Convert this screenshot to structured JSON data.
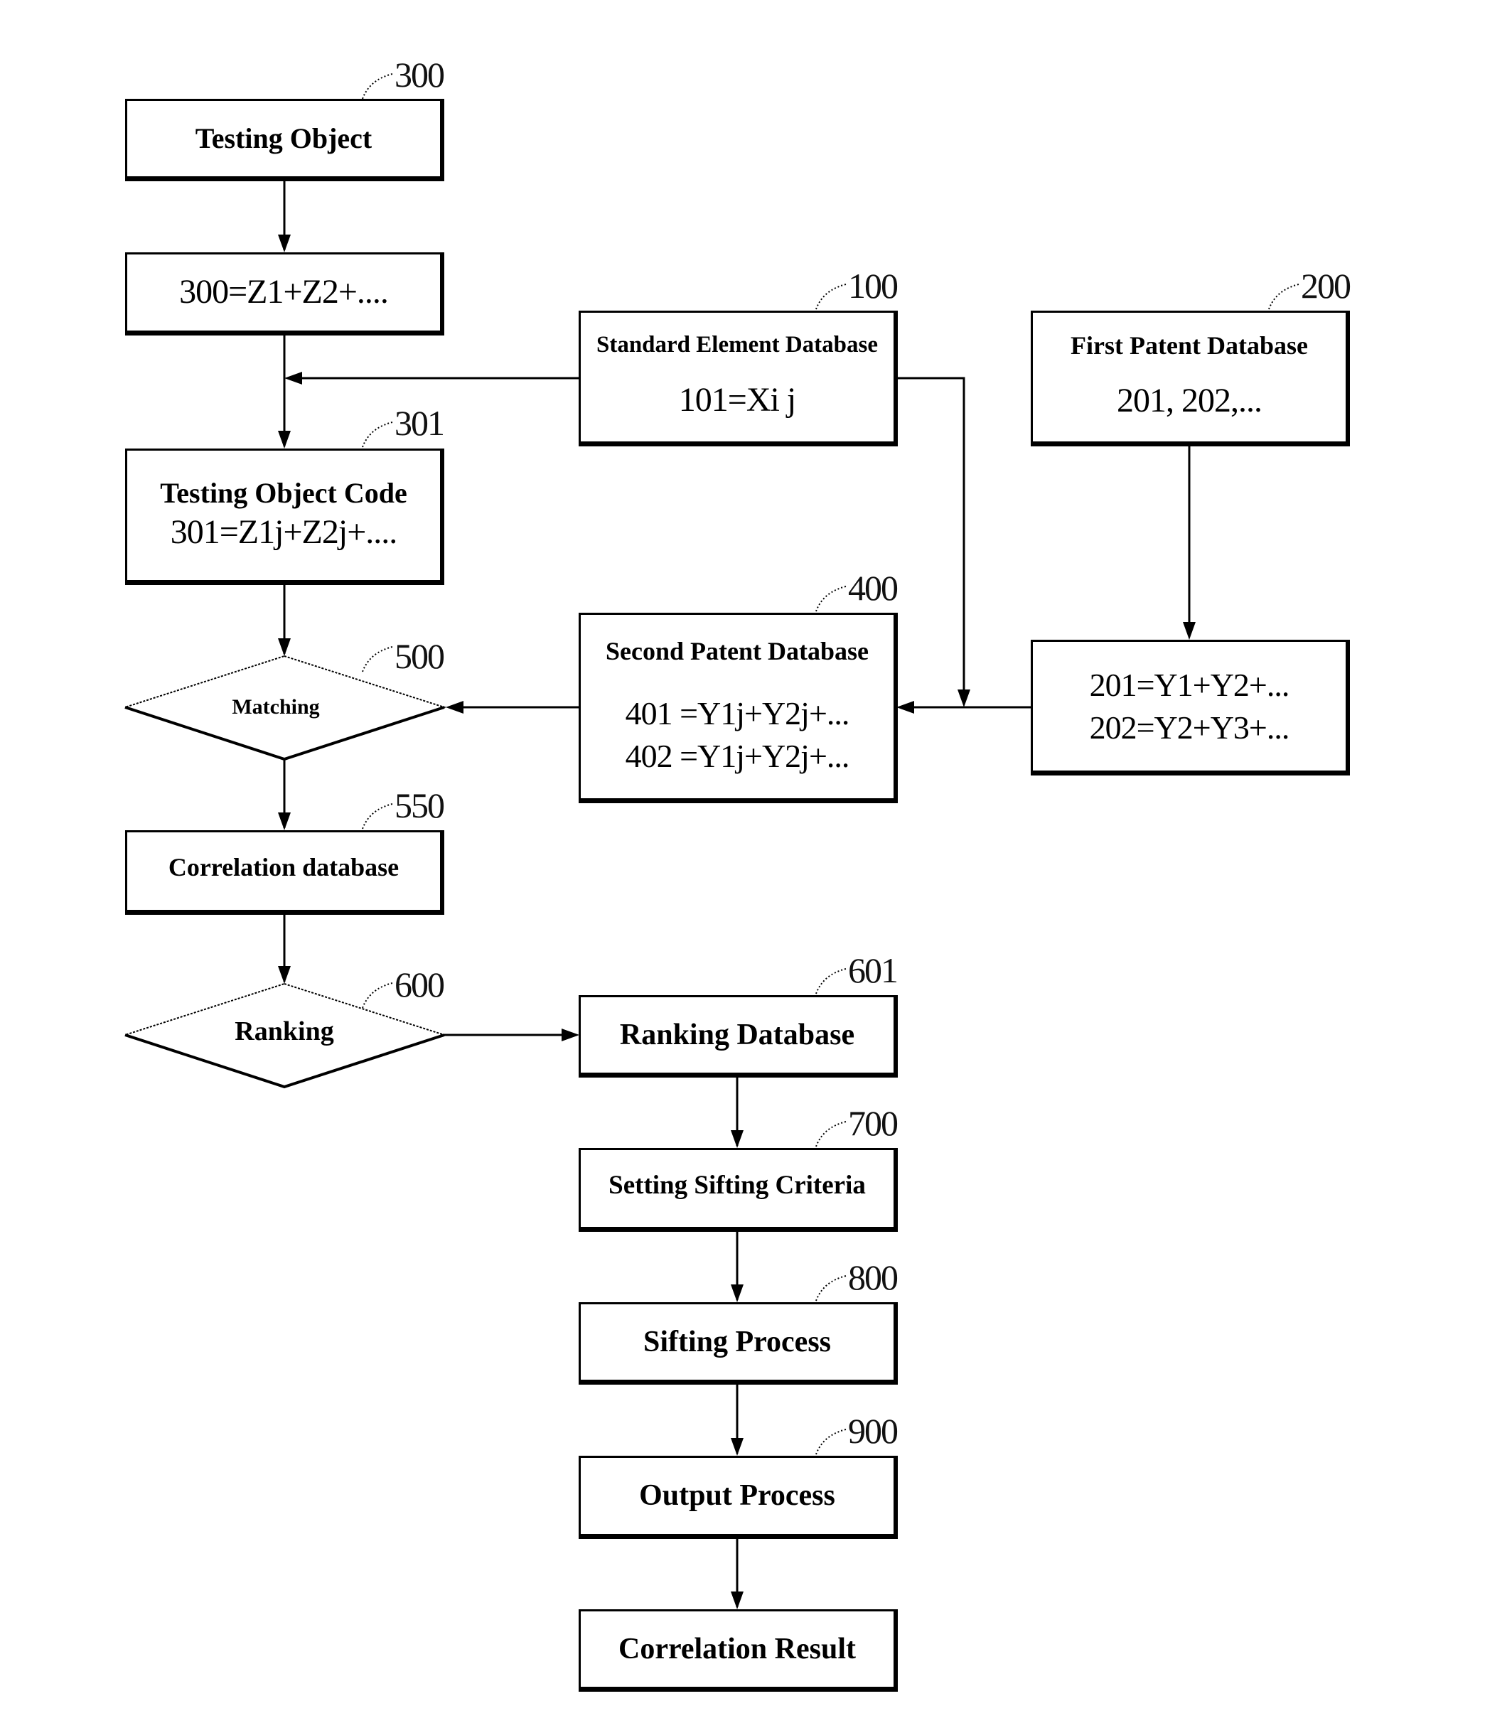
{
  "nodes": {
    "testing_object": {
      "ref": "300",
      "title": "Testing Object"
    },
    "testing_object_formula": {
      "formula": "300=Z1+Z2+...."
    },
    "standard_element_db": {
      "ref": "100",
      "title": "Standard Element Database",
      "formula": "101=Xi j"
    },
    "first_patent_db": {
      "ref": "200",
      "title": "First Patent Database",
      "formula": "201, 202,..."
    },
    "testing_object_code": {
      "ref": "301",
      "title": "Testing Object Code",
      "formula": "301=Z1j+Z2j+...."
    },
    "matching": {
      "ref": "500",
      "title": "Matching"
    },
    "second_patent_db": {
      "ref": "400",
      "title": "Second Patent Database",
      "formula_1": "401 =Y1j+Y2j+...",
      "formula_2": "402 =Y1j+Y2j+..."
    },
    "first_patent_formulas": {
      "formula_1": "201=Y1+Y2+...",
      "formula_2": "202=Y2+Y3+..."
    },
    "correlation_db": {
      "ref": "550",
      "title": "Correlation database"
    },
    "ranking": {
      "ref": "600",
      "title": "Ranking"
    },
    "ranking_db": {
      "ref": "601",
      "title": "Ranking Database"
    },
    "setting_sifting_criteria": {
      "ref": "700",
      "title": "Setting Sifting Criteria"
    },
    "sifting_process": {
      "ref": "800",
      "title": "Sifting Process"
    },
    "output_process": {
      "ref": "900",
      "title": "Output Process"
    },
    "correlation_result": {
      "title": "Correlation Result"
    }
  },
  "edges": [
    {
      "from": "Testing Object",
      "to": "300=Z1+Z2+...."
    },
    {
      "from": "300=Z1+Z2+....",
      "to": "Testing Object Code"
    },
    {
      "from": "Standard Element Database",
      "to": "Testing Object Code (merge)"
    },
    {
      "from": "Standard Element Database",
      "to": "Second Patent Database (merge)"
    },
    {
      "from": "First Patent Database",
      "to": "201/202 formulas"
    },
    {
      "from": "201/202 formulas",
      "to": "Second Patent Database"
    },
    {
      "from": "Testing Object Code",
      "to": "Matching"
    },
    {
      "from": "Second Patent Database",
      "to": "Matching"
    },
    {
      "from": "Matching",
      "to": "Correlation database"
    },
    {
      "from": "Correlation database",
      "to": "Ranking"
    },
    {
      "from": "Ranking",
      "to": "Ranking Database"
    },
    {
      "from": "Ranking Database",
      "to": "Setting Sifting Criteria"
    },
    {
      "from": "Setting Sifting Criteria",
      "to": "Sifting Process"
    },
    {
      "from": "Sifting Process",
      "to": "Output Process"
    },
    {
      "from": "Output Process",
      "to": "Correlation Result"
    }
  ]
}
